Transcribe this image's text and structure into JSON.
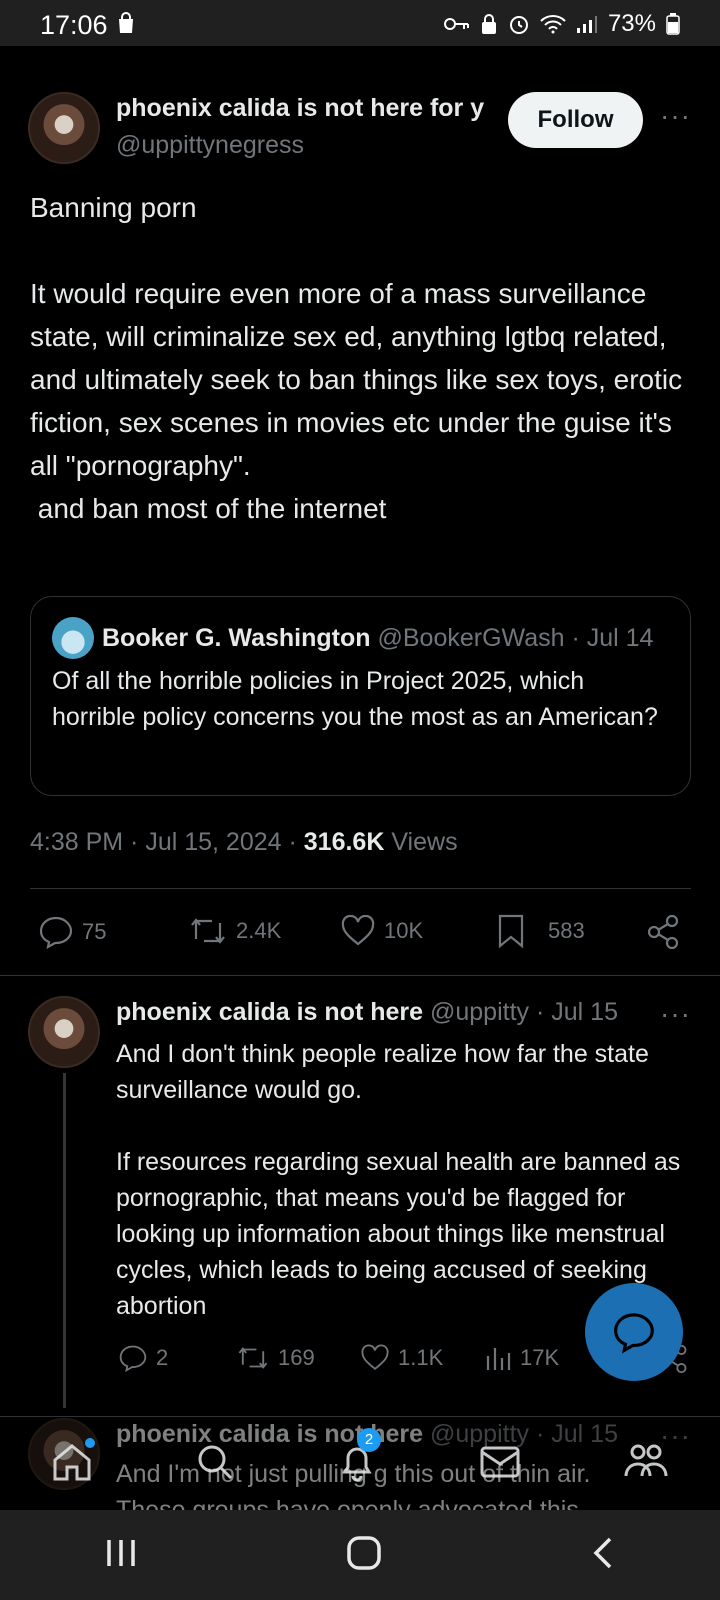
{
  "status_bar": {
    "time": "17:06",
    "battery": "73%"
  },
  "main_tweet": {
    "display_name": "phoenix calida is not here for y",
    "handle": "@uppittynegress",
    "follow_label": "Follow",
    "more": "···",
    "text": "Banning porn\n\nIt would require even more of a mass surveillance state, will criminalize sex ed, anything lgtbq related, and ultimately seek to ban things like sex toys, erotic fiction, sex scenes in movies etc under the guise it's all \"pornography\".\n and ban most of the internet",
    "quote": {
      "display_name": "Booker G. Washington",
      "handle": "@BookerGWash",
      "date": "· Jul 14",
      "text": "Of all the horrible policies in Project 2025, which horrible policy concerns you the most as an American?"
    },
    "timestamp": "4:38 PM · Jul 15, 2024 · ",
    "views_count": "316.6K",
    "views_label": " Views",
    "stats": {
      "replies": "75",
      "reposts": "2.4K",
      "likes": "10K",
      "bookmarks": "583"
    }
  },
  "reply_1": {
    "display_name": "phoenix calida is not here",
    "handle": "@uppitty",
    "date": "· Jul 15",
    "more": "···",
    "text": "And I don't think people realize how far the state surveillance would go.\n\nIf resources regarding sexual health are banned as pornographic, that means you'd be flagged for looking up information about things like menstrual cycles, which leads to being accused of seeking abortion",
    "stats": {
      "replies": "2",
      "reposts": "169",
      "likes": "1.1K",
      "views": "17K"
    }
  },
  "reply_2": {
    "display_name": "phoenix calida is not here",
    "handle": "@uppitty",
    "date": "· Jul 15",
    "more": "···",
    "text": "And I'm not just pulling g this out of thin air.\nThese groups have openly advocated this"
  },
  "bottom_nav": {
    "notifications_badge": "2"
  },
  "colors": {
    "accent": "#1d9bf0",
    "fab": "#1d6fb3",
    "muted": "#71767b",
    "text": "#e7e9ea"
  }
}
